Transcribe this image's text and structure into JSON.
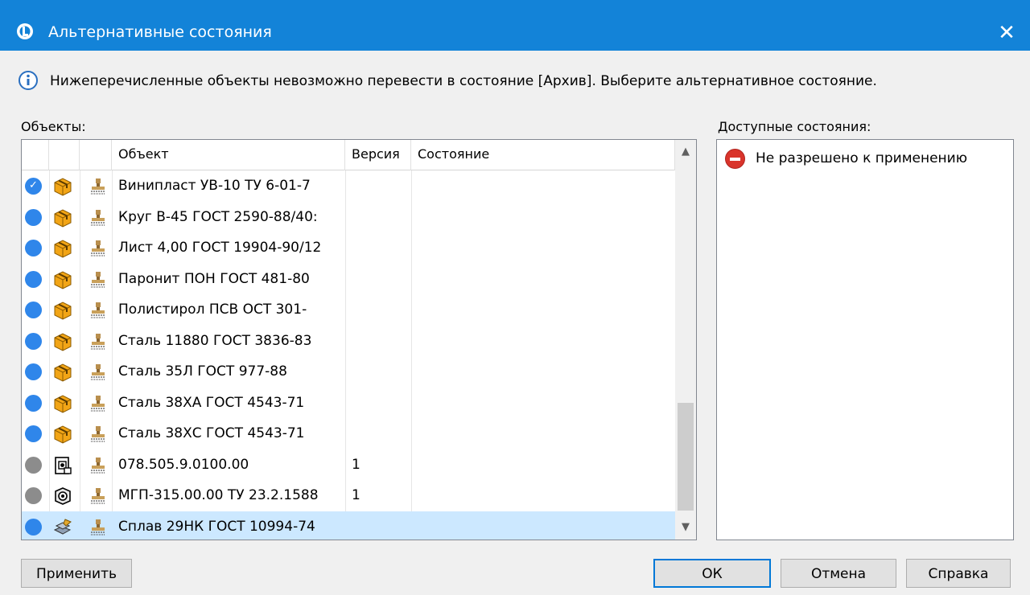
{
  "window": {
    "title": "Альтернативные состояния",
    "close_label": "✕"
  },
  "message": "Нижеперечисленные объекты невозможно перевести в состояние [Архив]. Выберите альтернативное состояние.",
  "objects_label": "Объекты:",
  "states_label": "Доступные состояния:",
  "table": {
    "columns": [
      "",
      "",
      "",
      "Объект",
      "Версия",
      "Состояние"
    ],
    "rows": [
      {
        "status": "checked",
        "icon": "material-box-icon",
        "name": "Винипласт УВ-10 ТУ 6-01-7",
        "version": "",
        "state": ""
      },
      {
        "status": "blue",
        "icon": "material-box-icon",
        "name": "Круг В-45 ГОСТ 2590-88/40:",
        "version": "",
        "state": ""
      },
      {
        "status": "blue",
        "icon": "material-box-icon",
        "name": "Лист 4,00 ГОСТ 19904-90/12",
        "version": "",
        "state": ""
      },
      {
        "status": "blue",
        "icon": "material-box-icon",
        "name": "Паронит ПОН ГОСТ 481-80",
        "version": "",
        "state": ""
      },
      {
        "status": "blue",
        "icon": "material-box-icon",
        "name": "Полистирол ПСВ ОСТ 301-",
        "version": "",
        "state": ""
      },
      {
        "status": "blue",
        "icon": "material-box-icon",
        "name": "Сталь 11880 ГОСТ 3836-83",
        "version": "",
        "state": ""
      },
      {
        "status": "blue",
        "icon": "material-box-icon",
        "name": "Сталь 35Л ГОСТ 977-88",
        "version": "",
        "state": ""
      },
      {
        "status": "blue",
        "icon": "material-box-icon",
        "name": "Сталь 38ХА ГОСТ 4543-71",
        "version": "",
        "state": ""
      },
      {
        "status": "blue",
        "icon": "material-box-icon",
        "name": "Сталь 38ХС ГОСТ 4543-71",
        "version": "",
        "state": ""
      },
      {
        "status": "grey",
        "icon": "drawing-document-icon",
        "name": "078.505.9.0100.00",
        "version": "1",
        "state": ""
      },
      {
        "status": "grey",
        "icon": "part-model-icon",
        "name": "МГП-315.00.00 ТУ 23.2.1588",
        "version": "1",
        "state": ""
      },
      {
        "status": "blue",
        "icon": "alloy-material-icon",
        "name": "Сплав 29НК ГОСТ 10994-74",
        "version": "",
        "state": "",
        "selected": true
      }
    ]
  },
  "available_states": [
    {
      "icon": "no-entry-icon",
      "label": "Не разрешено к применению"
    }
  ],
  "buttons": {
    "apply": "Применить",
    "ok": "ОК",
    "cancel": "Отмена",
    "help": "Справка"
  },
  "colors": {
    "titlebar": "#1383d8",
    "status_blue": "#2f86ea",
    "status_grey": "#8c8c8c",
    "selection": "#cce8ff"
  }
}
